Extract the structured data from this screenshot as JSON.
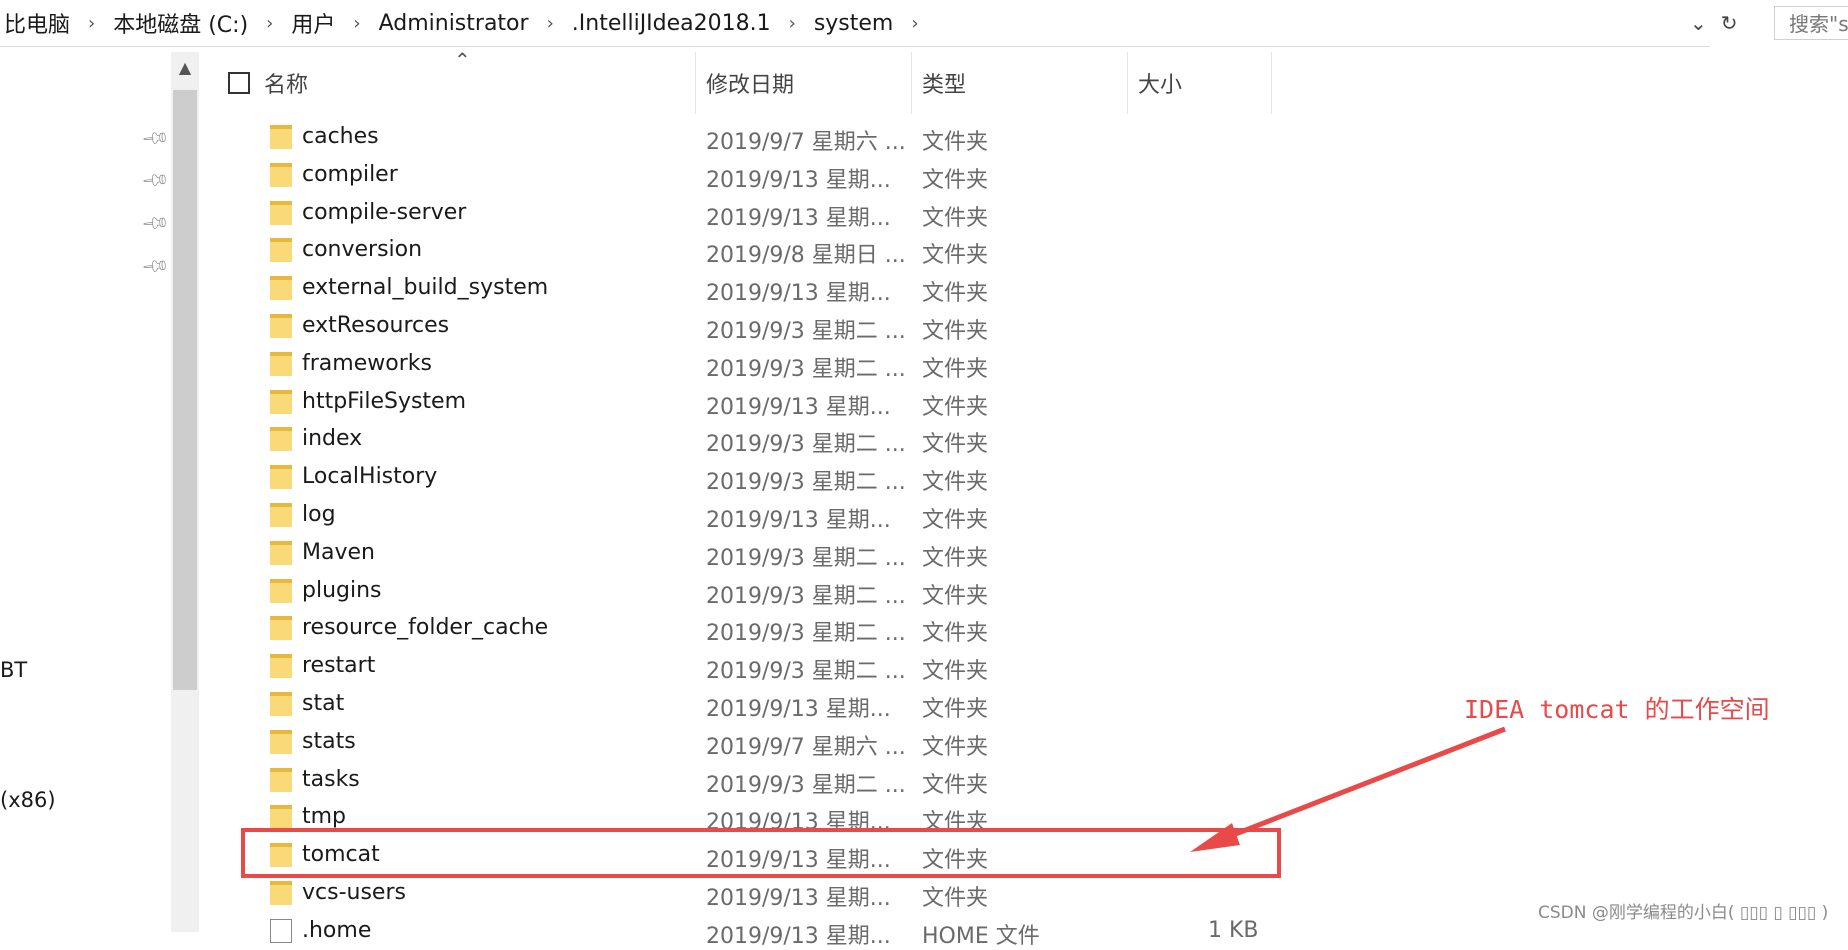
{
  "breadcrumbs": [
    "比电脑",
    "本地磁盘 (C:)",
    "用户",
    "Administrator",
    ".IntelliJIdea2018.1",
    "system"
  ],
  "search": {
    "placeholder": "搜索\"s"
  },
  "nav": {
    "labels": [
      "BT",
      "(x86)"
    ]
  },
  "columns": {
    "name": "名称",
    "date": "修改日期",
    "type": "类型",
    "size": "大小"
  },
  "rows": [
    {
      "name": "caches",
      "date": "2019/9/7 星期六 ...",
      "type": "文件夹",
      "size": "",
      "kind": "folder"
    },
    {
      "name": "compiler",
      "date": "2019/9/13 星期...",
      "type": "文件夹",
      "size": "",
      "kind": "folder"
    },
    {
      "name": "compile-server",
      "date": "2019/9/13 星期...",
      "type": "文件夹",
      "size": "",
      "kind": "folder"
    },
    {
      "name": "conversion",
      "date": "2019/9/8 星期日 ...",
      "type": "文件夹",
      "size": "",
      "kind": "folder"
    },
    {
      "name": "external_build_system",
      "date": "2019/9/13 星期...",
      "type": "文件夹",
      "size": "",
      "kind": "folder"
    },
    {
      "name": "extResources",
      "date": "2019/9/3 星期二 ...",
      "type": "文件夹",
      "size": "",
      "kind": "folder"
    },
    {
      "name": "frameworks",
      "date": "2019/9/3 星期二 ...",
      "type": "文件夹",
      "size": "",
      "kind": "folder"
    },
    {
      "name": "httpFileSystem",
      "date": "2019/9/13 星期...",
      "type": "文件夹",
      "size": "",
      "kind": "folder"
    },
    {
      "name": "index",
      "date": "2019/9/3 星期二 ...",
      "type": "文件夹",
      "size": "",
      "kind": "folder"
    },
    {
      "name": "LocalHistory",
      "date": "2019/9/3 星期二 ...",
      "type": "文件夹",
      "size": "",
      "kind": "folder"
    },
    {
      "name": "log",
      "date": "2019/9/13 星期...",
      "type": "文件夹",
      "size": "",
      "kind": "folder"
    },
    {
      "name": "Maven",
      "date": "2019/9/3 星期二 ...",
      "type": "文件夹",
      "size": "",
      "kind": "folder"
    },
    {
      "name": "plugins",
      "date": "2019/9/3 星期二 ...",
      "type": "文件夹",
      "size": "",
      "kind": "folder"
    },
    {
      "name": "resource_folder_cache",
      "date": "2019/9/3 星期二 ...",
      "type": "文件夹",
      "size": "",
      "kind": "folder"
    },
    {
      "name": "restart",
      "date": "2019/9/3 星期二 ...",
      "type": "文件夹",
      "size": "",
      "kind": "folder"
    },
    {
      "name": "stat",
      "date": "2019/9/13 星期...",
      "type": "文件夹",
      "size": "",
      "kind": "folder"
    },
    {
      "name": "stats",
      "date": "2019/9/7 星期六 ...",
      "type": "文件夹",
      "size": "",
      "kind": "folder"
    },
    {
      "name": "tasks",
      "date": "2019/9/3 星期二 ...",
      "type": "文件夹",
      "size": "",
      "kind": "folder"
    },
    {
      "name": "tmp",
      "date": "2019/9/13 星期...",
      "type": "文件夹",
      "size": "",
      "kind": "folder"
    },
    {
      "name": "tomcat",
      "date": "2019/9/13 星期...",
      "type": "文件夹",
      "size": "",
      "kind": "folder"
    },
    {
      "name": "vcs-users",
      "date": "2019/9/13 星期...",
      "type": "文件夹",
      "size": "",
      "kind": "folder"
    },
    {
      "name": ".home",
      "date": "2019/9/13 星期...",
      "type": "HOME 文件",
      "size": "1 KB",
      "kind": "file"
    }
  ],
  "annotation": {
    "text": "IDEA tomcat 的工作空间",
    "color": "#e84949"
  },
  "watermark": "CSDN @刚学编程的小白( ▯▯▯ ▯ ▯▯▯ )"
}
